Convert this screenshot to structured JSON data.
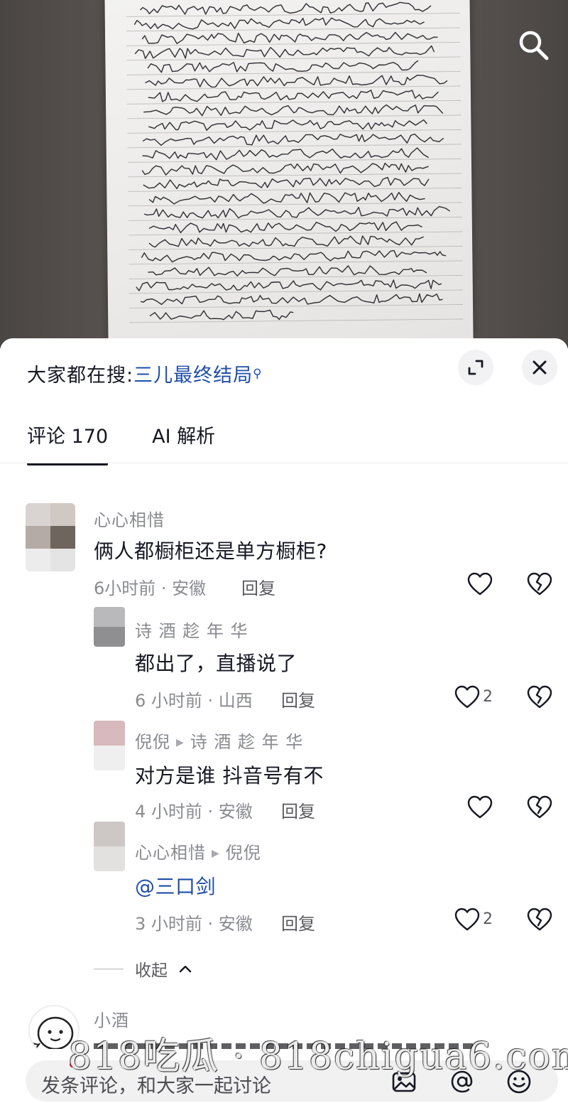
{
  "hot_search": {
    "prefix": "大家都在搜:",
    "keyword": "三儿最终结局"
  },
  "tabs": [
    {
      "label": "评论 170",
      "active": true
    },
    {
      "label": "AI 解析",
      "active": false
    }
  ],
  "comments": [
    {
      "user": "心心相惜",
      "text": "俩人都橱柜还是单方橱柜?",
      "time": "6小时前 · 安徽",
      "reply": "回复",
      "likes": ""
    },
    {
      "user": "诗 酒 趁 年 华",
      "text": "都出了，直播说了",
      "time": "6 小时前 · 山西",
      "reply": "回复",
      "likes": "2"
    },
    {
      "user": "倪倪",
      "reply_to": "诗 酒 趁 年 华",
      "text": "对方是谁  抖音号有不",
      "time": "4 小时前 · 安徽",
      "reply": "回复",
      "likes": ""
    },
    {
      "user": "心心相惜",
      "reply_to": "倪倪",
      "text": "@三口剑",
      "time": "3 小时前 · 安徽",
      "reply": "回复",
      "likes": "2"
    },
    {
      "user": "小酒"
    }
  ],
  "collapse_label": "收起",
  "input": {
    "placeholder": "发条评论，和大家一起讨论"
  },
  "watermark": "818吃瓜 · 818chigua6.com",
  "colors": {
    "link": "#1f4fa8",
    "text": "#161823",
    "secondary": "#8a8b91",
    "sheet_bg": "#ffffff",
    "pill_bg": "#f1f1f2"
  }
}
